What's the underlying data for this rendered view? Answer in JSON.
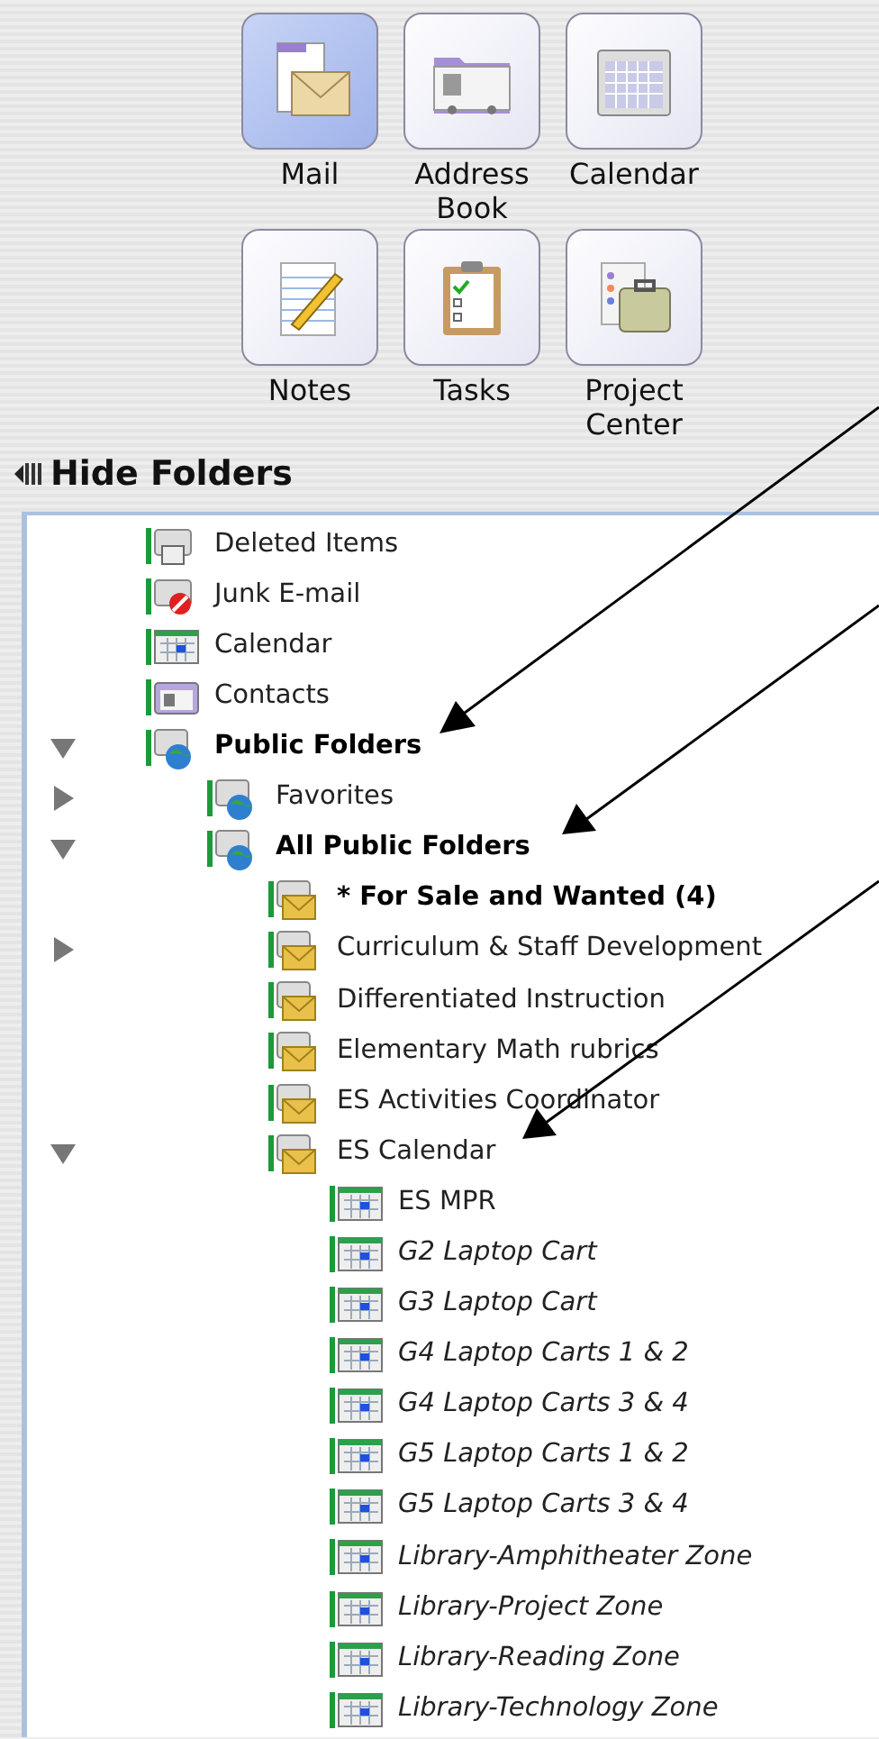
{
  "toolbar": [
    {
      "kind": "mail",
      "label": "Mail",
      "selected": true
    },
    {
      "kind": "address-book",
      "label": "Address Book",
      "selected": false
    },
    {
      "kind": "calendar",
      "label": "Calendar",
      "selected": false
    },
    {
      "kind": "notes",
      "label": "Notes",
      "selected": false
    },
    {
      "kind": "tasks",
      "label": "Tasks",
      "selected": false
    },
    {
      "kind": "project-center",
      "label": "Project Center",
      "selected": false
    }
  ],
  "hide_folders": {
    "label": "Hide Folders"
  },
  "folders": [
    {
      "kind": "trash",
      "label": "Deleted Items",
      "unread": false,
      "offline": false
    },
    {
      "kind": "junk",
      "label": "Junk E-mail",
      "unread": false,
      "offline": false
    },
    {
      "kind": "calendar",
      "label": "Calendar",
      "unread": false,
      "offline": false
    },
    {
      "kind": "contacts",
      "label": "Contacts",
      "unread": false,
      "offline": false
    },
    {
      "kind": "public",
      "label": "Public Folders",
      "unread": true,
      "offline": false,
      "expanded": true,
      "children": [
        {
          "kind": "public",
          "label": "Favorites",
          "unread": false,
          "offline": false,
          "expanded": false
        },
        {
          "kind": "public",
          "label": "All Public Folders",
          "unread": true,
          "offline": false,
          "expanded": true,
          "children": [
            {
              "kind": "mail",
              "label": "* For Sale and Wanted (4)",
              "unread": true,
              "offline": false
            },
            {
              "kind": "mail",
              "label": "Curriculum & Staff Development",
              "unread": false,
              "offline": false,
              "expanded": false
            },
            {
              "kind": "mail",
              "label": "Differentiated Instruction",
              "unread": false,
              "offline": false
            },
            {
              "kind": "mail",
              "label": "Elementary Math rubrics",
              "unread": false,
              "offline": false
            },
            {
              "kind": "mail",
              "label": "ES Activities Coordinator",
              "unread": false,
              "offline": false
            },
            {
              "kind": "mail",
              "label": "ES Calendar",
              "unread": false,
              "offline": false,
              "expanded": true,
              "children": [
                {
                  "kind": "calendar",
                  "label": "ES MPR",
                  "unread": false,
                  "offline": false
                },
                {
                  "kind": "calendar",
                  "label": "G2 Laptop Cart",
                  "unread": false,
                  "offline": true
                },
                {
                  "kind": "calendar",
                  "label": "G3 Laptop Cart",
                  "unread": false,
                  "offline": true
                },
                {
                  "kind": "calendar",
                  "label": "G4 Laptop Carts 1 & 2",
                  "unread": false,
                  "offline": true
                },
                {
                  "kind": "calendar",
                  "label": "G4 Laptop Carts 3 & 4",
                  "unread": false,
                  "offline": true
                },
                {
                  "kind": "calendar",
                  "label": "G5 Laptop Carts 1 & 2",
                  "unread": false,
                  "offline": true
                },
                {
                  "kind": "calendar",
                  "label": "G5 Laptop Carts 3 & 4",
                  "unread": false,
                  "offline": true
                },
                {
                  "kind": "calendar",
                  "label": "Library-Amphitheater Zone",
                  "unread": false,
                  "offline": true
                },
                {
                  "kind": "calendar",
                  "label": "Library-Project Zone",
                  "unread": false,
                  "offline": true
                },
                {
                  "kind": "calendar",
                  "label": "Library-Reading Zone",
                  "unread": false,
                  "offline": true
                },
                {
                  "kind": "calendar",
                  "label": "Library-Technology Zone",
                  "unread": false,
                  "offline": true
                }
              ]
            }
          ]
        }
      ]
    }
  ]
}
